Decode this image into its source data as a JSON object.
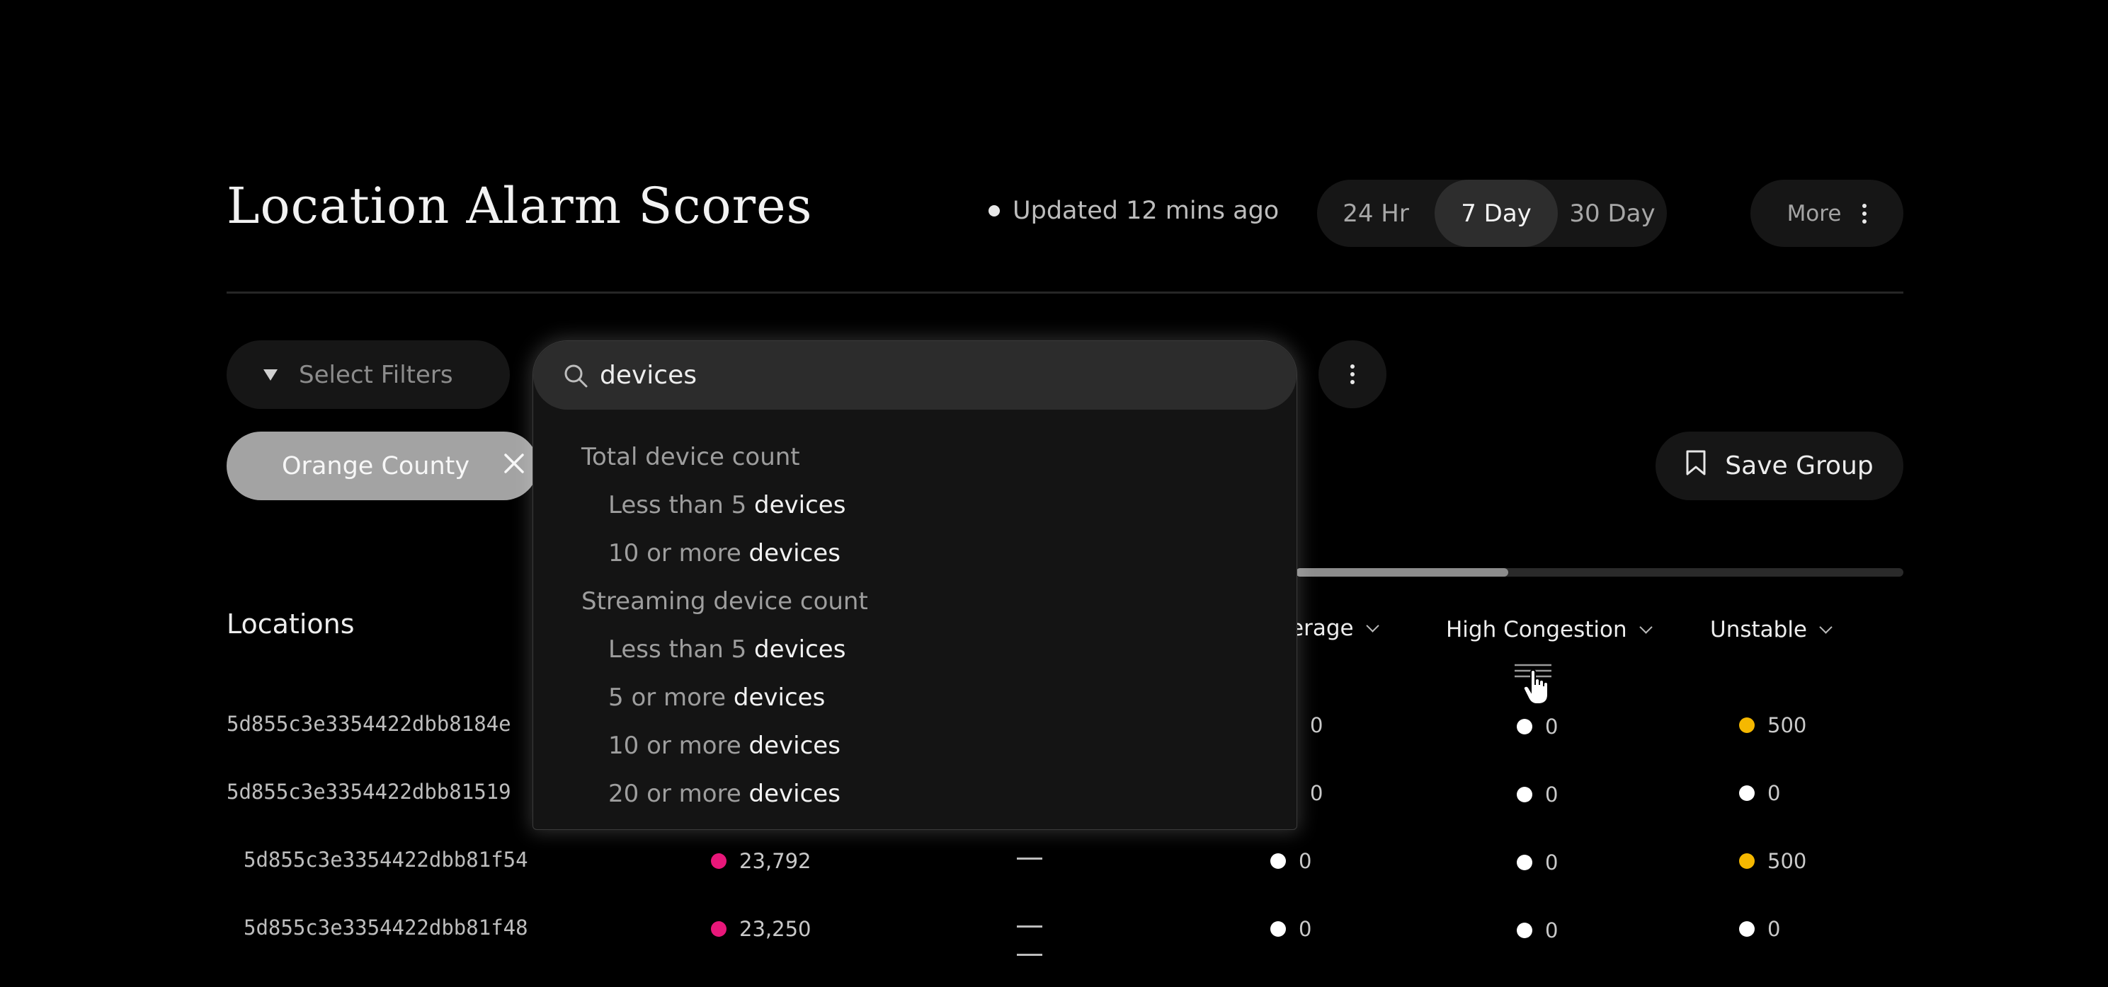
{
  "header": {
    "title": "Location Alarm Scores",
    "updated": "Updated 12 mins ago",
    "ranges": [
      "24 Hr",
      "7 Day",
      "30 Day"
    ],
    "active_range": "7 Day",
    "more_label": "More"
  },
  "filters": {
    "select_label": "Select Filters",
    "chip_label": "Orange County",
    "save_group_label": "Save Group",
    "scroll_progress": 0.35
  },
  "search": {
    "value": "devices",
    "groups": [
      {
        "label": "Total device count",
        "items": [
          {
            "prefix": "Less than 5",
            "match": "devices"
          },
          {
            "prefix": "10 or more",
            "match": "devices"
          }
        ]
      },
      {
        "label": "Streaming device count",
        "items": [
          {
            "prefix": "Less than 5",
            "match": "devices"
          },
          {
            "prefix": "5 or more",
            "match": "devices"
          },
          {
            "prefix": "10 or more",
            "match": "devices"
          },
          {
            "prefix": "20 or more",
            "match": "devices"
          }
        ]
      }
    ]
  },
  "table": {
    "locations_label": "Locations",
    "columns": {
      "coverage_partial": "erage",
      "high_congestion": "High Congestion",
      "unstable": "Unstable"
    },
    "rows": [
      {
        "id": "5d855c3e3354422dbb8184e",
        "score": "",
        "coverage": "0",
        "congestion": "0",
        "unstable": "500",
        "unstable_color": "#f5b800"
      },
      {
        "id": "5d855c3e3354422dbb81519",
        "score": "",
        "coverage": "0",
        "congestion": "0",
        "unstable": "0",
        "unstable_color": "#ffffff"
      },
      {
        "id": "5d855c3e3354422dbb81f54",
        "score": "23,792",
        "coverage": "0",
        "congestion": "0",
        "unstable": "500",
        "unstable_color": "#f5b800"
      },
      {
        "id": "5d855c3e3354422dbb81f48",
        "score": "23,250",
        "coverage": "0",
        "congestion": "0",
        "unstable": "0",
        "unstable_color": "#ffffff"
      }
    ],
    "score_color": "#e8177a"
  },
  "icons": [
    "caret-down-icon",
    "search-icon",
    "close-icon",
    "bookmark-icon",
    "kebab-icon",
    "chevron-down-icon",
    "column-menu-icon",
    "hand-cursor-icon"
  ]
}
